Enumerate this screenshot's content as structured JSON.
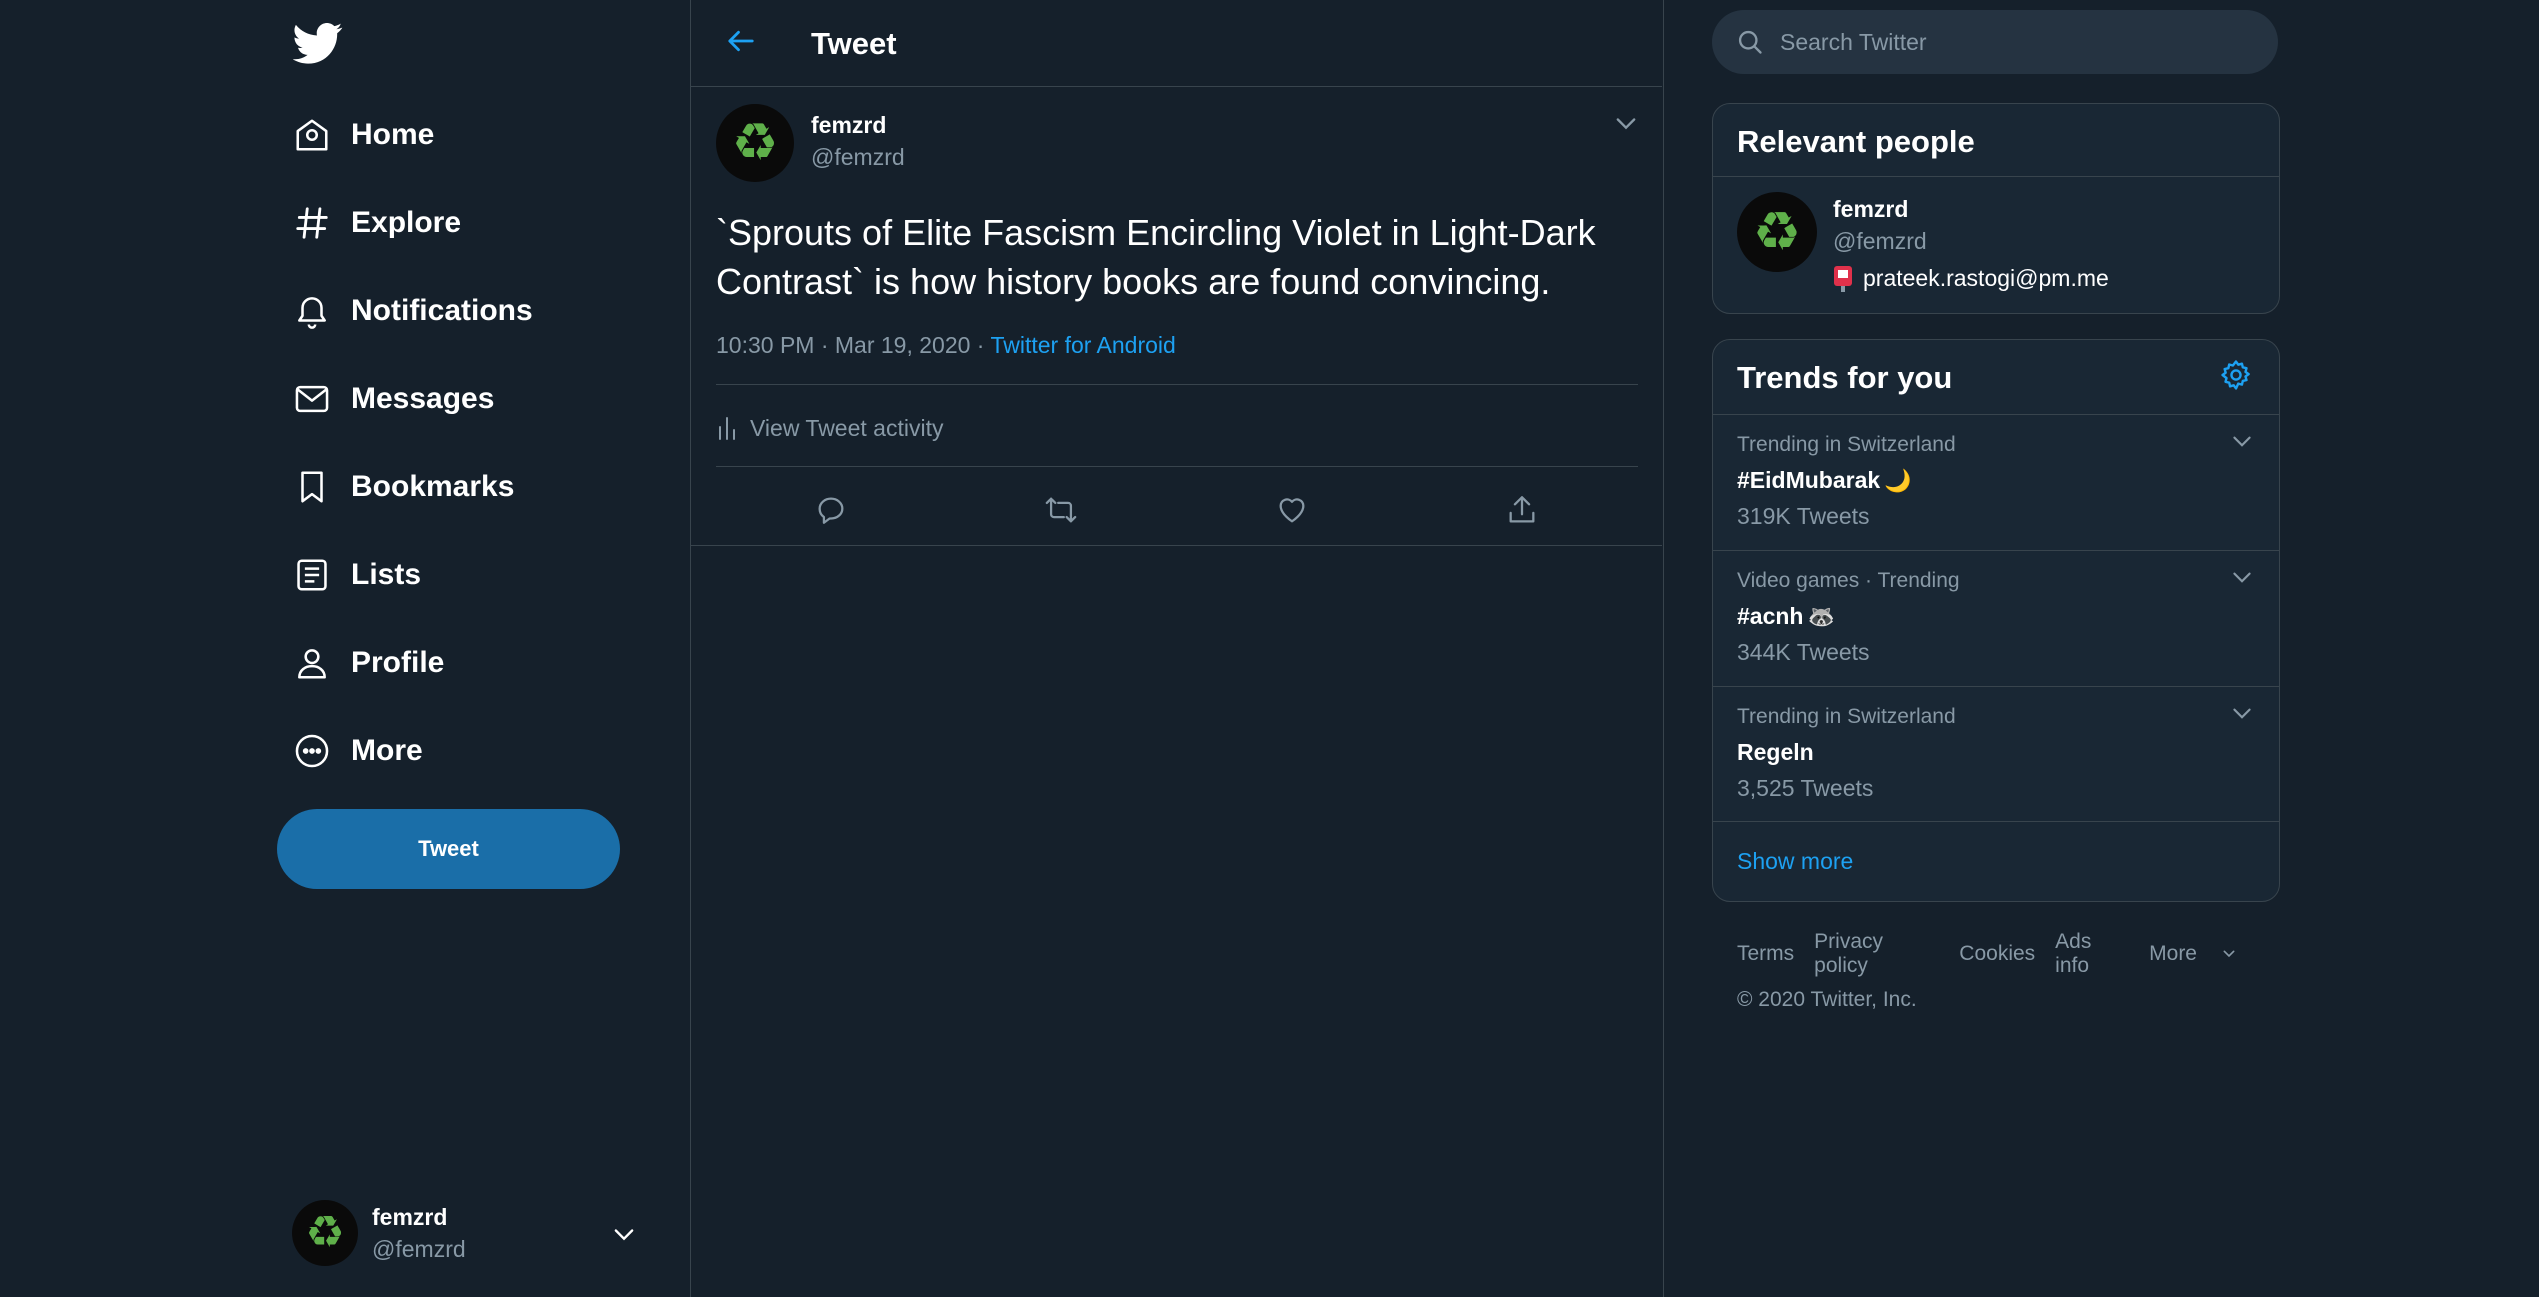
{
  "nav": {
    "items": [
      {
        "label": "Home",
        "icon": "home-icon"
      },
      {
        "label": "Explore",
        "icon": "hashtag-icon"
      },
      {
        "label": "Notifications",
        "icon": "bell-icon"
      },
      {
        "label": "Messages",
        "icon": "envelope-icon"
      },
      {
        "label": "Bookmarks",
        "icon": "bookmark-icon"
      },
      {
        "label": "Lists",
        "icon": "list-icon"
      },
      {
        "label": "Profile",
        "icon": "person-icon"
      },
      {
        "label": "More",
        "icon": "more-circle-icon"
      }
    ],
    "tweet_button": "Tweet"
  },
  "account": {
    "name": "femzrd",
    "handle": "@femzrd"
  },
  "header": {
    "title": "Tweet"
  },
  "tweet": {
    "name": "femzrd",
    "handle": "@femzrd",
    "text": "`Sprouts of Elite Fascism Encircling Violet in Light-Dark Contrast` is how history books are found convincing.",
    "time": "10:30 PM · Mar 19, 2020 · ",
    "source": "Twitter for Android",
    "activity_label": "View Tweet activity"
  },
  "search": {
    "placeholder": "Search Twitter"
  },
  "relevant": {
    "title": "Relevant people",
    "name": "femzrd",
    "handle": "@femzrd",
    "bio": "prateek.rastogi@pm.me"
  },
  "trends": {
    "title": "Trends for you",
    "items": [
      {
        "context": "Trending in Switzerland",
        "name": "#EidMubarak",
        "emoji": "🌙",
        "count": "319K Tweets"
      },
      {
        "context": "Video games · Trending",
        "name": "#acnh",
        "emoji": "🦝",
        "count": "344K Tweets"
      },
      {
        "context": "Trending in Switzerland",
        "name": "Regeln",
        "emoji": "",
        "count": "3,525 Tweets"
      }
    ],
    "show_more": "Show more"
  },
  "footer": {
    "links": [
      "Terms",
      "Privacy policy",
      "Cookies",
      "Ads info",
      "More"
    ],
    "copyright": "© 2020 Twitter, Inc."
  },
  "colors": {
    "background": "#15202b",
    "accent": "#1da1f2",
    "button": "#1a6ea8",
    "muted": "#8899a6",
    "recycle": "#5fb04a"
  }
}
